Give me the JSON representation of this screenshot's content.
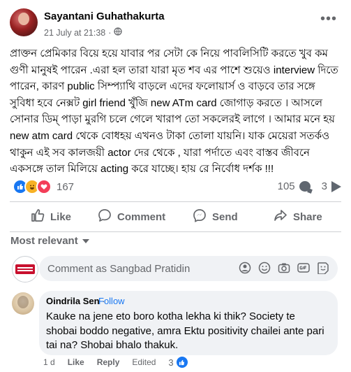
{
  "post": {
    "author": "Sayantani Guhathakurta",
    "timestamp": "21 July at 21:38",
    "dot": "·",
    "audience_icon": "globe-icon",
    "more_icon": "more-dots-icon",
    "text": "প্রাক্তন প্রেমিকার বিয়ে হয়ে যাবার পর সেটা কে নিয়ে পাবলিসিটি করতে খুব কম গুণী মানুষই পারেন .এরা হল তারা যারা মৃত শব এর পাশে শুয়েও interview দিতে পারেন, কারণ public সিম্প্যাথি বাড়লে এদের ফলোয়ার্স ও বাড়বে তার সঙ্গে সুবিধা হবে নেক্সট girl friend খুঁজি new ATm card জোগাড় করতে । আসলে সোনার ডিম্ পাড়া মুরগি চলে গেলে খারাপ তো সকলেরই লাগে । আমার মনে হয় new atm card থেকে বোধহয় এখনও টাকা তোলা যায়নি। যাক মেয়েরা সতর্কও থাকুন এই সব কালজয়ী actor দের থেকে , যারা পর্দাতে এবং বাস্তব জীবনে একসঙ্গে তাল মিলিয়ে acting করে যাচ্ছে। হায় রে নির্বোধ দর্শক !!!"
  },
  "stats": {
    "reactions_count": "167",
    "reaction_icons": [
      "like-icon",
      "haha-icon",
      "love-icon"
    ],
    "comments_count": "105",
    "shares_count": "3"
  },
  "actions": {
    "like": "Like",
    "comment": "Comment",
    "send": "Send",
    "share": "Share"
  },
  "sort": {
    "label": "Most relevant"
  },
  "composer": {
    "placeholder": "Comment as Sangbad Pratidin",
    "icons": [
      "avatar-sticker-icon",
      "emoji-icon",
      "camera-icon",
      "gif-icon",
      "sticker-icon"
    ]
  },
  "comment": {
    "author": "Oindrila Sen",
    "dot": "·",
    "follow": "Follow",
    "text": "Kauke na jene eto boro kotha lekha ki thik? Society te shobai boddo negative, amra Ektu positivity chailei ante pari tai na? Shobai bhalo thakuk.",
    "age": "1 d",
    "like": "Like",
    "reply": "Reply",
    "edited": "Edited",
    "like_count": "3"
  },
  "colors": {
    "accent": "#1877f2",
    "secondary_text": "#65676b",
    "bubble_bg": "#f0f2f5"
  }
}
